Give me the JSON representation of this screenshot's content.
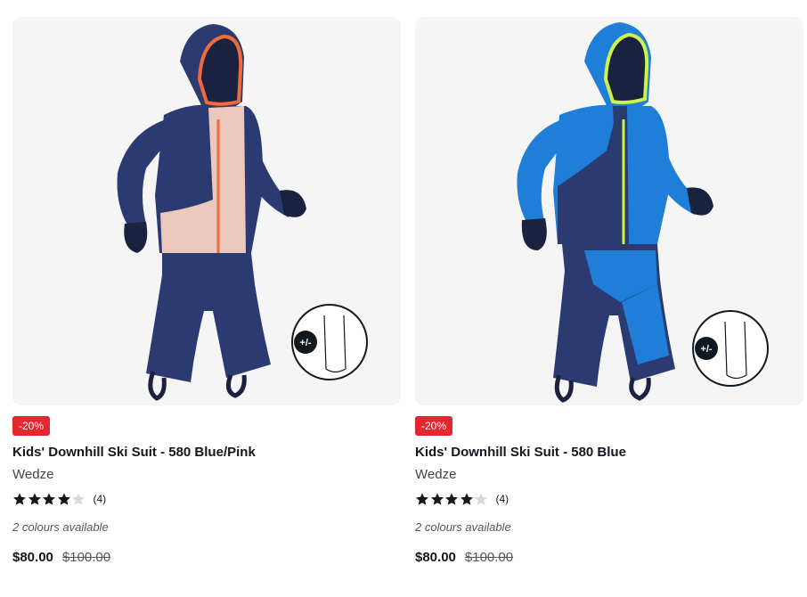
{
  "products": [
    {
      "badge": "-20%",
      "title": "Kids' Downhill Ski Suit - 580 Blue/Pink",
      "brand": "Wedze",
      "rating": 4,
      "rating_max": 5,
      "review_count": "(4)",
      "colours": "2 colours available",
      "price": "$80.00",
      "old_price": "$100.00",
      "image_icon": "ski-suit-blue-pink-icon",
      "colors": {
        "jacket": "#2c3a72",
        "panel": "#ecc8bd",
        "zip": "#f06a3d",
        "pants": "#2c3a72"
      }
    },
    {
      "badge": "-20%",
      "title": "Kids' Downhill Ski Suit - 580 Blue",
      "brand": "Wedze",
      "rating": 4,
      "rating_max": 5,
      "review_count": "(4)",
      "colours": "2 colours available",
      "price": "$80.00",
      "old_price": "$100.00",
      "image_icon": "ski-suit-blue-icon",
      "colors": {
        "jacket": "#1f7fd8",
        "panel": "#1f7fd8",
        "zip": "#cdf24b",
        "pants": "#1f7fd8"
      }
    }
  ],
  "theme": {
    "badge_bg": "#e3262f",
    "star_filled": "#101820",
    "star_empty": "#d9d9d9",
    "image_bg": "#f5f5f5"
  }
}
